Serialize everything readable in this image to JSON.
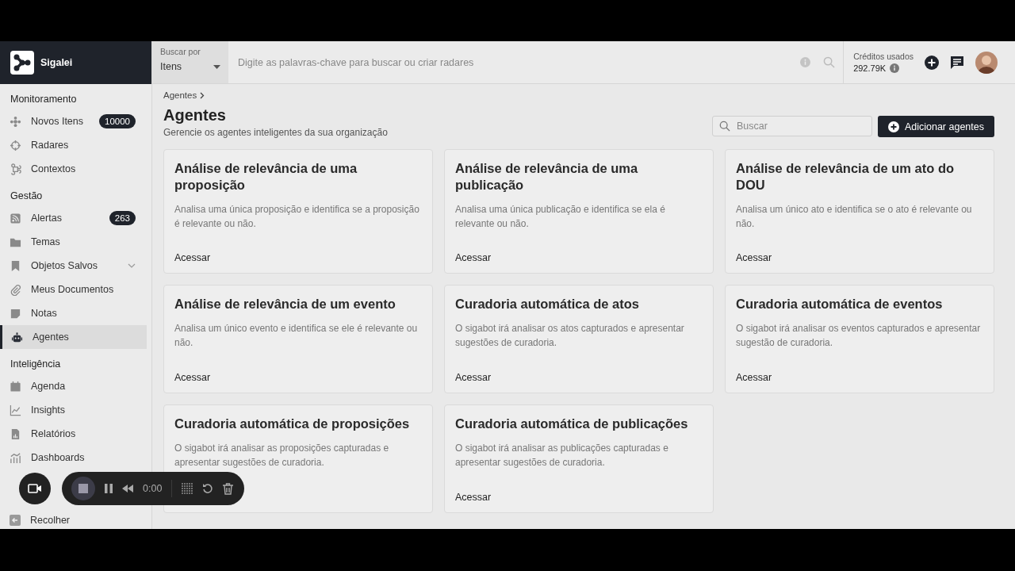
{
  "brand": {
    "name": "Sigalei"
  },
  "sidebar": {
    "sections": [
      {
        "title": "Monitoramento",
        "items": [
          {
            "label": "Novos Itens",
            "kind": "nodes",
            "badge": "10000",
            "selected": false
          },
          {
            "label": "Radares",
            "kind": "target",
            "selected": false
          },
          {
            "label": "Contextos",
            "kind": "command",
            "selected": false
          }
        ]
      },
      {
        "title": "Gestão",
        "items": [
          {
            "label": "Alertas",
            "kind": "rss",
            "badge": "263",
            "selected": false
          },
          {
            "label": "Temas",
            "kind": "folder",
            "selected": false
          },
          {
            "label": "Objetos Salvos",
            "kind": "bookmark",
            "expanded": false,
            "selected": false
          },
          {
            "label": "Meus Documentos",
            "kind": "clip",
            "selected": false
          },
          {
            "label": "Notas",
            "kind": "note",
            "selected": false
          },
          {
            "label": "Agentes",
            "kind": "robot",
            "selected": true
          }
        ]
      },
      {
        "title": "Inteligência",
        "items": [
          {
            "label": "Agenda",
            "kind": "calendar",
            "selected": false
          },
          {
            "label": "Insights",
            "kind": "chart",
            "selected": false
          },
          {
            "label": "Relatórios",
            "kind": "report",
            "selected": false
          },
          {
            "label": "Dashboards",
            "kind": "bars",
            "selected": false
          }
        ]
      }
    ],
    "collapse": "Recolher"
  },
  "search": {
    "scope_label": "Buscar por",
    "scope_value": "Itens",
    "placeholder": "Digite as palavras-chave para buscar ou criar radares"
  },
  "credits": {
    "label": "Créditos usados",
    "value": "292.79K"
  },
  "breadcrumb": [
    "Agentes"
  ],
  "page": {
    "title": "Agentes",
    "subtitle": "Gerencie os agentes inteligentes da sua organização"
  },
  "filter": {
    "placeholder": "Buscar"
  },
  "add_button": "Adicionar agentes",
  "cards": [
    {
      "title": "Análise de relevância de uma proposição",
      "description": "Analisa uma única proposição e identifica se a proposição é relevante ou não.",
      "link": "Acessar"
    },
    {
      "title": "Análise de relevância de uma publicação",
      "description": "Analisa uma única publicação e identifica se ela é relevante ou não.",
      "link": "Acessar"
    },
    {
      "title": "Análise de relevância de um ato do DOU",
      "description": "Analisa um único ato e identifica se o ato é relevante ou não.",
      "link": "Acessar"
    },
    {
      "title": "Análise de relevância de um evento",
      "description": "Analisa um único evento e identifica se ele é relevante ou não.",
      "link": "Acessar"
    },
    {
      "title": "Curadoria automática de atos",
      "description": "O sigabot irá analisar os atos capturados e apresentar sugestões de curadoria.",
      "link": "Acessar"
    },
    {
      "title": "Curadoria automática de eventos",
      "description": "O sigabot irá analisar os eventos capturados e apresentar sugestão de curadoria.",
      "link": "Acessar"
    },
    {
      "title": "Curadoria automática de proposições",
      "description": "O sigabot irá analisar as proposições capturadas e apresentar sugestões de curadoria."
    },
    {
      "title": "Curadoria automática de publicações",
      "description": "O sigabot irá analisar as publicações capturadas e apresentar sugestões de curadoria.",
      "link": "Acessar"
    }
  ],
  "recorder": {
    "time": "0:00"
  }
}
